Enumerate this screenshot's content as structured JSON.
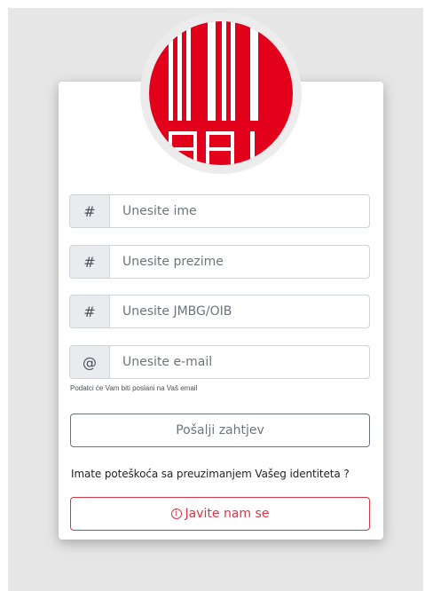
{
  "form": {
    "fields": [
      {
        "icon_glyph": "#",
        "icon": "hash-icon",
        "placeholder": "Unesite ime"
      },
      {
        "icon_glyph": "#",
        "icon": "hash-icon",
        "placeholder": "Unesite prezime"
      },
      {
        "icon_glyph": "#",
        "icon": "hash-icon",
        "placeholder": "Unesite JMBG/OIB"
      },
      {
        "icon_glyph": "@",
        "icon": "at-sign-icon",
        "placeholder": "Unesite e-mail"
      }
    ],
    "hint": "Podatci će Vam biti poslani na Vaš email",
    "submit_label": "Pošalji zahtjev"
  },
  "help": {
    "question": "Imate poteškoća sa preuzimanjem Vašeg identiteta ?",
    "contact_icon": "i",
    "contact_label": "Javite nam se"
  },
  "colors": {
    "brand_red": "#e2001a",
    "danger": "#dc3545",
    "secondary": "#6c757d"
  }
}
